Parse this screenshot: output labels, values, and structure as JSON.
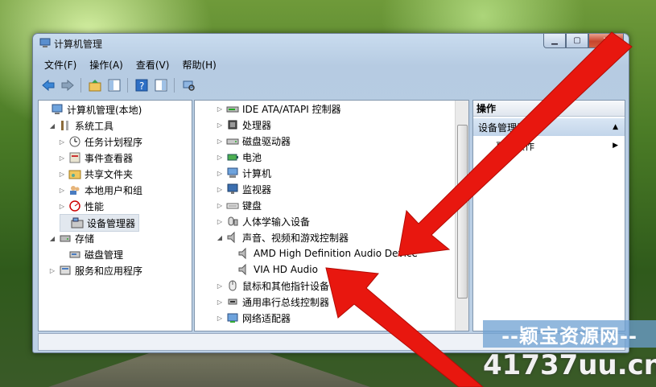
{
  "window": {
    "title": "计算机管理"
  },
  "menubar": [
    "文件(F)",
    "操作(A)",
    "查看(V)",
    "帮助(H)"
  ],
  "toolbar_icons": [
    "back-arrow-icon",
    "forward-arrow-icon",
    "up-folder-icon",
    "show-hide-tree-icon",
    "help-icon",
    "properties-icon",
    "scan-hardware-icon"
  ],
  "left_tree": [
    {
      "label": "计算机管理(本地)",
      "icon": "computer-management-icon",
      "expander": ""
    },
    {
      "label": "系统工具",
      "icon": "tools-icon",
      "expander": "◢"
    },
    {
      "label": "任务计划程序",
      "icon": "clock-icon",
      "expander": "▷"
    },
    {
      "label": "事件查看器",
      "icon": "event-viewer-icon",
      "expander": "▷"
    },
    {
      "label": "共享文件夹",
      "icon": "shared-folder-icon",
      "expander": "▷"
    },
    {
      "label": "本地用户和组",
      "icon": "users-icon",
      "expander": "▷"
    },
    {
      "label": "性能",
      "icon": "performance-icon",
      "expander": "▷"
    },
    {
      "label": "设备管理器",
      "icon": "device-manager-icon",
      "expander": "",
      "selected": true
    },
    {
      "label": "存储",
      "icon": "storage-icon",
      "expander": "◢"
    },
    {
      "label": "磁盘管理",
      "icon": "disk-management-icon",
      "expander": ""
    },
    {
      "label": "服务和应用程序",
      "icon": "services-icon",
      "expander": "▷"
    }
  ],
  "device_tree": [
    {
      "label": "IDE ATA/ATAPI 控制器",
      "icon": "ide-controller-icon",
      "expander": "▷"
    },
    {
      "label": "处理器",
      "icon": "processor-icon",
      "expander": "▷"
    },
    {
      "label": "磁盘驱动器",
      "icon": "disk-drive-icon",
      "expander": "▷"
    },
    {
      "label": "电池",
      "icon": "battery-icon",
      "expander": "▷"
    },
    {
      "label": "计算机",
      "icon": "computer-icon",
      "expander": "▷"
    },
    {
      "label": "监视器",
      "icon": "monitor-icon",
      "expander": "▷"
    },
    {
      "label": "键盘",
      "icon": "keyboard-icon",
      "expander": "▷"
    },
    {
      "label": "人体学输入设备",
      "icon": "hid-icon",
      "expander": "▷"
    },
    {
      "label": "声音、视频和游戏控制器",
      "icon": "speaker-icon",
      "expander": "◢"
    },
    {
      "label": "AMD High Definition Audio Device",
      "icon": "speaker-icon",
      "expander": "",
      "child": true
    },
    {
      "label": "VIA HD Audio",
      "icon": "speaker-icon",
      "expander": "",
      "child": true
    },
    {
      "label": "鼠标和其他指针设备",
      "icon": "mouse-icon",
      "expander": "▷"
    },
    {
      "label": "通用串行总线控制器",
      "icon": "usb-icon",
      "expander": "▷"
    },
    {
      "label": "网络适配器",
      "icon": "network-adapter-icon",
      "expander": "▷"
    }
  ],
  "actions": {
    "header": "操作",
    "group": "设备管理器",
    "more": "更多操作"
  },
  "watermark": {
    "line1": "--颖宝资源网--",
    "line2a": "417",
    "line2b": "37uu.cn"
  },
  "colors": {
    "arrow": "#e8170f",
    "selection": "#e2e8ef",
    "action_group": "#c2d5ea"
  }
}
